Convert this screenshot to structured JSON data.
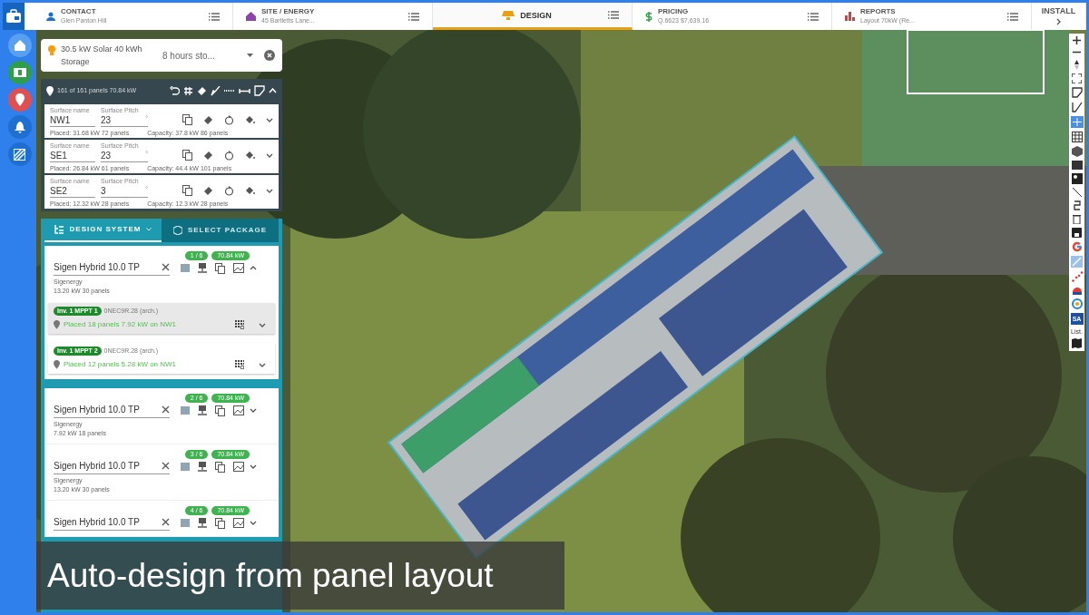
{
  "nav_tabs": [
    {
      "kind": "contact",
      "label": "CONTACT",
      "subtitle": "Glen Panton Hill",
      "selected": false
    },
    {
      "kind": "site",
      "label": "SITE / ENERGY",
      "subtitle": "45 Bartletts Lane...",
      "selected": false
    },
    {
      "kind": "design",
      "label": "DESIGN",
      "selected": true
    },
    {
      "kind": "pricing",
      "label": "PRICING",
      "subtitle": "Q.6623 $7,639.16",
      "selected": false
    },
    {
      "kind": "reports",
      "label": "REPORTS",
      "subtitle": "Layout 70kW (Re...",
      "selected": false
    },
    {
      "kind": "install",
      "label": "INSTALL",
      "selected": false
    }
  ],
  "package": {
    "title": "30.5 kW Solar 40 kWh Storage",
    "dropdown": "8 hours sto..."
  },
  "surfaces_summary": "161 of 161 panels 70.84 kW",
  "surfaces": [
    {
      "name_label": "Surface name",
      "name": "NW1",
      "pitch_label": "Surface Pitch",
      "pitch": "23",
      "unit": "°",
      "placed": "Placed: 31.68 kW 72 panels",
      "capacity": "Capacity: 37.8 kW 86 panels"
    },
    {
      "name_label": "Surface name",
      "name": "SE1",
      "pitch_label": "Surface Pitch",
      "pitch": "23",
      "unit": "°",
      "placed": "Placed: 26.84 kW 61 panels",
      "capacity": "Capacity: 44.4 kW 101 panels"
    },
    {
      "name_label": "Surface name",
      "name": "SE2",
      "pitch_label": "Surface Pitch",
      "pitch": "3",
      "unit": "°",
      "placed": "Placed: 12.32 kW 28 panels",
      "capacity": "Capacity: 12.3 kW 28 panels"
    }
  ],
  "design_tabs": [
    {
      "label": "DESIGN SYSTEM",
      "selected": true
    },
    {
      "label": "SELECT PACKAGE",
      "selected": false
    }
  ],
  "inverters": [
    {
      "index": "1 / 6",
      "power": "70.84 kW",
      "name": "Sigen Hybrid 10.0 TP",
      "brand": "Sigenergy",
      "summary": "13.20 kW 30 panels",
      "expanded": true,
      "mppts": [
        {
          "tag": "Inv. 1 MPPT 1",
          "model": "0NEC9R.28 (arch.)",
          "placed": "Placed 18 panels 7.92 kW on NW1",
          "selected": true
        },
        {
          "tag": "Inv. 1 MPPT 2",
          "model": "0NEC9R.28 (arch.)",
          "placed": "Placed 12 panels 5.28 kW on NW1",
          "selected": false
        }
      ]
    },
    {
      "index": "2 / 6",
      "power": "70.84 kW",
      "name": "Sigen Hybrid 10.0 TP",
      "brand": "Sigenergy",
      "summary": "7.92 kW 18 panels",
      "expanded": false
    },
    {
      "index": "3 / 6",
      "power": "70.84 kW",
      "name": "Sigen Hybrid 10.0 TP",
      "brand": "Sigenergy",
      "summary": "13.20 kW 30 panels",
      "expanded": false
    },
    {
      "index": "4 / 6",
      "power": "70.84 kW",
      "name": "Sigen Hybrid 10.0 TP",
      "expanded": false
    }
  ],
  "map_toolbar": {
    "sa_label": "SA",
    "list_label": "List."
  },
  "caption": "Auto-design from panel layout"
}
